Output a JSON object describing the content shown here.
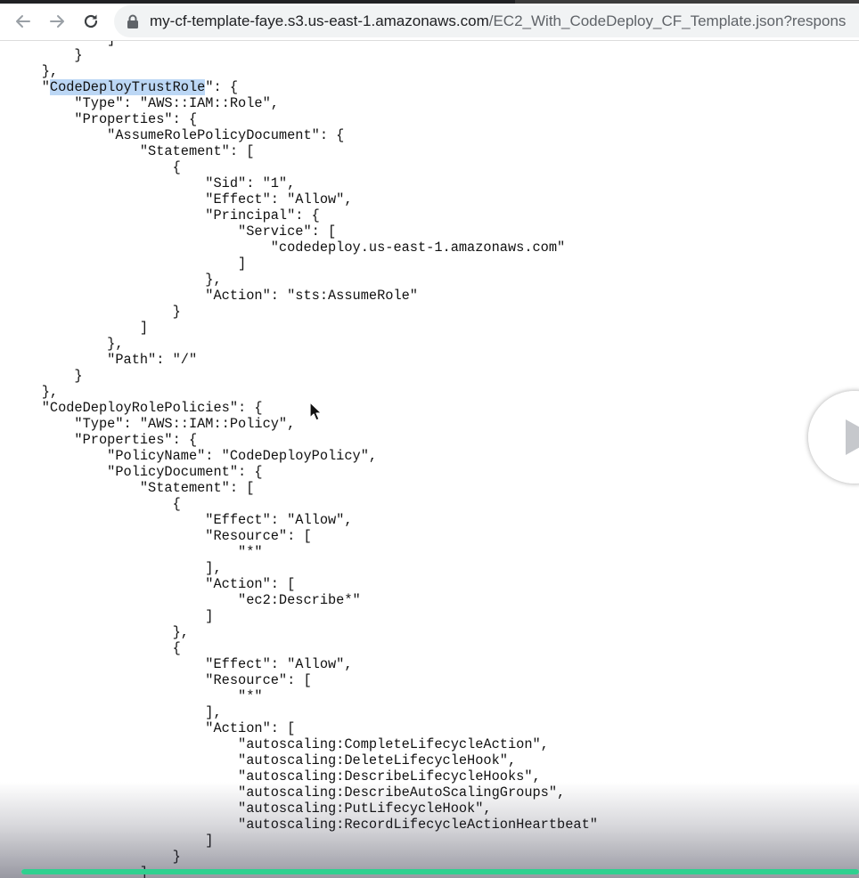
{
  "browser": {
    "url_host": "my-cf-template-faye.s3.us-east-1.amazonaws.com",
    "url_path": "/EC2_With_CodeDeploy_CF_Template.json?respons",
    "icons": {
      "back": "arrow-left-icon",
      "forward": "arrow-right-icon",
      "reload": "reload-icon",
      "secure": "lock-icon"
    }
  },
  "document": {
    "highlight": "CodeDeployTrustRole",
    "lines": [
      "            ]",
      "        }",
      "    },",
      "    \"CodeDeployTrustRole\": {",
      "        \"Type\": \"AWS::IAM::Role\",",
      "        \"Properties\": {",
      "            \"AssumeRolePolicyDocument\": {",
      "                \"Statement\": [",
      "                    {",
      "                        \"Sid\": \"1\",",
      "                        \"Effect\": \"Allow\",",
      "                        \"Principal\": {",
      "                            \"Service\": [",
      "                                \"codedeploy.us-east-1.amazonaws.com\"",
      "                            ]",
      "                        },",
      "                        \"Action\": \"sts:AssumeRole\"",
      "                    }",
      "                ]",
      "            },",
      "            \"Path\": \"/\"",
      "        }",
      "    },",
      "    \"CodeDeployRolePolicies\": {",
      "        \"Type\": \"AWS::IAM::Policy\",",
      "        \"Properties\": {",
      "            \"PolicyName\": \"CodeDeployPolicy\",",
      "            \"PolicyDocument\": {",
      "                \"Statement\": [",
      "                    {",
      "                        \"Effect\": \"Allow\",",
      "                        \"Resource\": [",
      "                            \"*\"",
      "                        ],",
      "                        \"Action\": [",
      "                            \"ec2:Describe*\"",
      "                        ]",
      "                    },",
      "                    {",
      "                        \"Effect\": \"Allow\",",
      "                        \"Resource\": [",
      "                            \"*\"",
      "                        ],",
      "                        \"Action\": [",
      "                            \"autoscaling:CompleteLifecycleAction\",",
      "                            \"autoscaling:DeleteLifecycleHook\",",
      "                            \"autoscaling:DescribeLifecycleHooks\",",
      "                            \"autoscaling:DescribeAutoScalingGroups\",",
      "                            \"autoscaling:PutLifecycleHook\",",
      "                            \"autoscaling:RecordLifecycleActionHeartbeat\"",
      "                        ]",
      "                    }",
      "                ]"
    ]
  },
  "video_overlay": {
    "progress": 1.0,
    "progress_color": "#2fd08f",
    "play_icon": "play-icon"
  }
}
